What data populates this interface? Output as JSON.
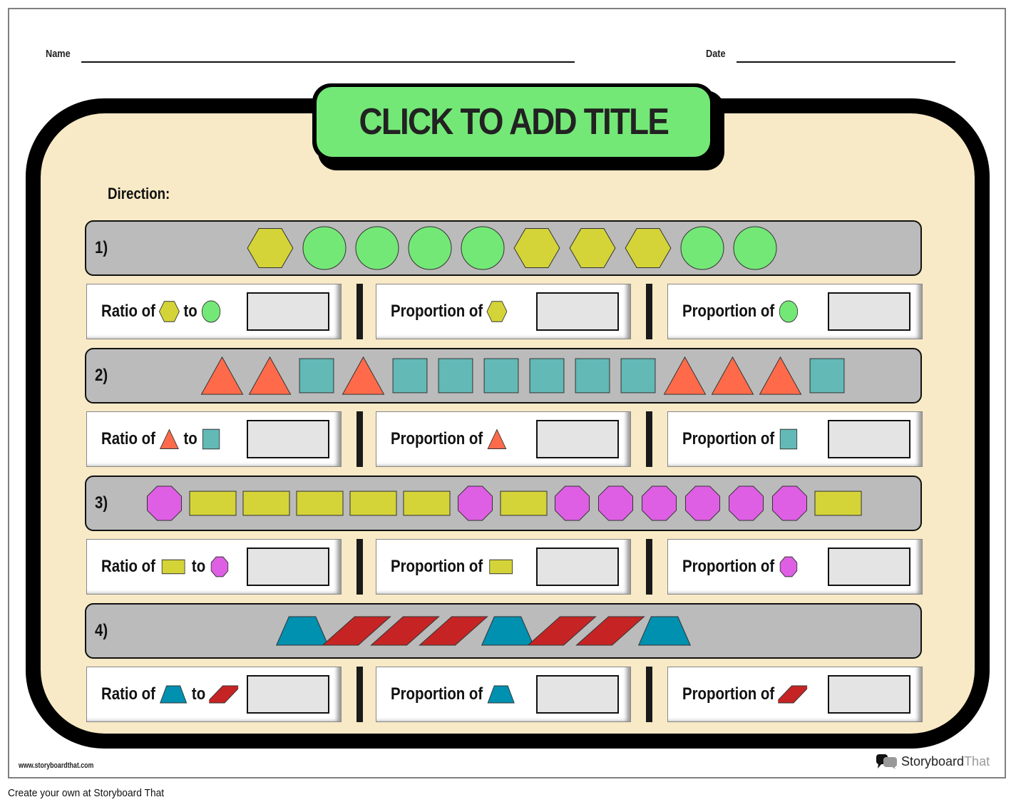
{
  "header": {
    "name_label": "Name",
    "date_label": "Date"
  },
  "title": "CLICK TO ADD TITLE",
  "direction_label": "Direction:",
  "colors": {
    "frame_bg": "#f8eac6",
    "title_green": "#74e877",
    "row_gray": "#bbbbbb",
    "answer_gray": "#e4e4e4",
    "hexagon_yellow": "#d4d438",
    "circle_green": "#74e877",
    "triangle_orange": "#ff6b4a",
    "square_teal": "#62b9b6",
    "octagon_magenta": "#de5fe4",
    "rectangle_yellow": "#d4d438",
    "trapezoid_blue": "#0090b0",
    "parallelogram_red": "#c62424"
  },
  "problems": [
    {
      "number": "1)",
      "sequence": [
        "hexagon",
        "circle",
        "circle",
        "circle",
        "circle",
        "hexagon",
        "hexagon",
        "hexagon",
        "circle",
        "circle"
      ],
      "shape_a": "hexagon",
      "shape_b": "circle",
      "ratio_label": "Ratio of",
      "to_label": "to",
      "proportion_a_label": "Proportion of",
      "proportion_b_label": "Proportion of",
      "answers": [
        "",
        "",
        ""
      ]
    },
    {
      "number": "2)",
      "sequence": [
        "triangle",
        "triangle",
        "square",
        "triangle",
        "square",
        "square",
        "square",
        "square",
        "square",
        "square",
        "triangle",
        "triangle",
        "triangle",
        "square"
      ],
      "shape_a": "triangle",
      "shape_b": "square",
      "ratio_label": "Ratio of",
      "to_label": "to",
      "proportion_a_label": "Proportion of",
      "proportion_b_label": "Proportion of",
      "answers": [
        "",
        "",
        ""
      ]
    },
    {
      "number": "3)",
      "sequence": [
        "octagon",
        "rectangle",
        "rectangle",
        "rectangle",
        "rectangle",
        "rectangle",
        "octagon",
        "rectangle",
        "octagon",
        "octagon",
        "octagon",
        "octagon",
        "octagon",
        "octagon",
        "rectangle"
      ],
      "shape_a": "rectangle",
      "shape_b": "octagon",
      "ratio_label": "Ratio of",
      "to_label": "to",
      "proportion_a_label": "Proportion of",
      "proportion_b_label": "Proportion of",
      "answers": [
        "",
        "",
        ""
      ]
    },
    {
      "number": "4)",
      "sequence": [
        "trapezoid",
        "parallelogram",
        "parallelogram",
        "parallelogram",
        "trapezoid",
        "parallelogram",
        "parallelogram",
        "trapezoid"
      ],
      "shape_a": "trapezoid",
      "shape_b": "parallelogram",
      "ratio_label": "Ratio of",
      "to_label": "to",
      "proportion_a_label": "Proportion of",
      "proportion_b_label": "Proportion of",
      "answers": [
        "",
        "",
        ""
      ]
    }
  ],
  "footer": {
    "url": "www.storyboardthat.com",
    "brand_main": "Storyboard",
    "brand_accent": "That",
    "create_text": "Create your own at Storyboard That"
  }
}
